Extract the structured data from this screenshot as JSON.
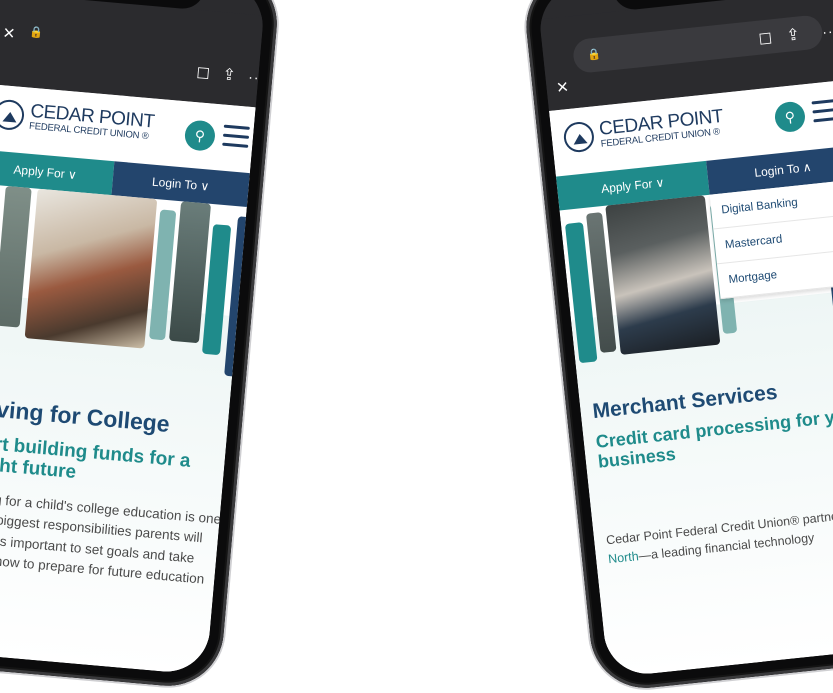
{
  "left_phone": {
    "site": {
      "logo_main": "CEDAR POINT",
      "logo_sub": "FEDERAL CREDIT UNION ®",
      "nav": {
        "apply": "Apply For ∨",
        "login": "Login To ∨"
      }
    },
    "content": {
      "title": "Saving for College",
      "subtitle": "Start building funds for a bright future",
      "body": "Paying for a child's college education is one of the biggest responsibilities parents will face. It's important to set goals and take action now to prepare for future education costs."
    }
  },
  "right_phone": {
    "site": {
      "logo_main": "CEDAR POINT",
      "logo_sub": "FEDERAL CREDIT UNION ®",
      "nav": {
        "apply": "Apply For ∨",
        "login": "Login To ∧"
      },
      "login_menu": [
        "Digital Banking",
        "Mastercard",
        "Mortgage"
      ]
    },
    "content": {
      "title": "Merchant Services",
      "subtitle": "Credit card processing for your business",
      "body_pre": "Cedar Point Federal Credit Union® partners with ",
      "body_link": "North",
      "body_post": "—a leading financial technology"
    }
  },
  "browser": {
    "close": "×",
    "lock": "🔒",
    "bookmark": "☐",
    "share": "⇪",
    "more": "···"
  },
  "colors": {
    "teal": "#1f8b8b",
    "navy": "#23456d",
    "title": "#1e4a73"
  }
}
